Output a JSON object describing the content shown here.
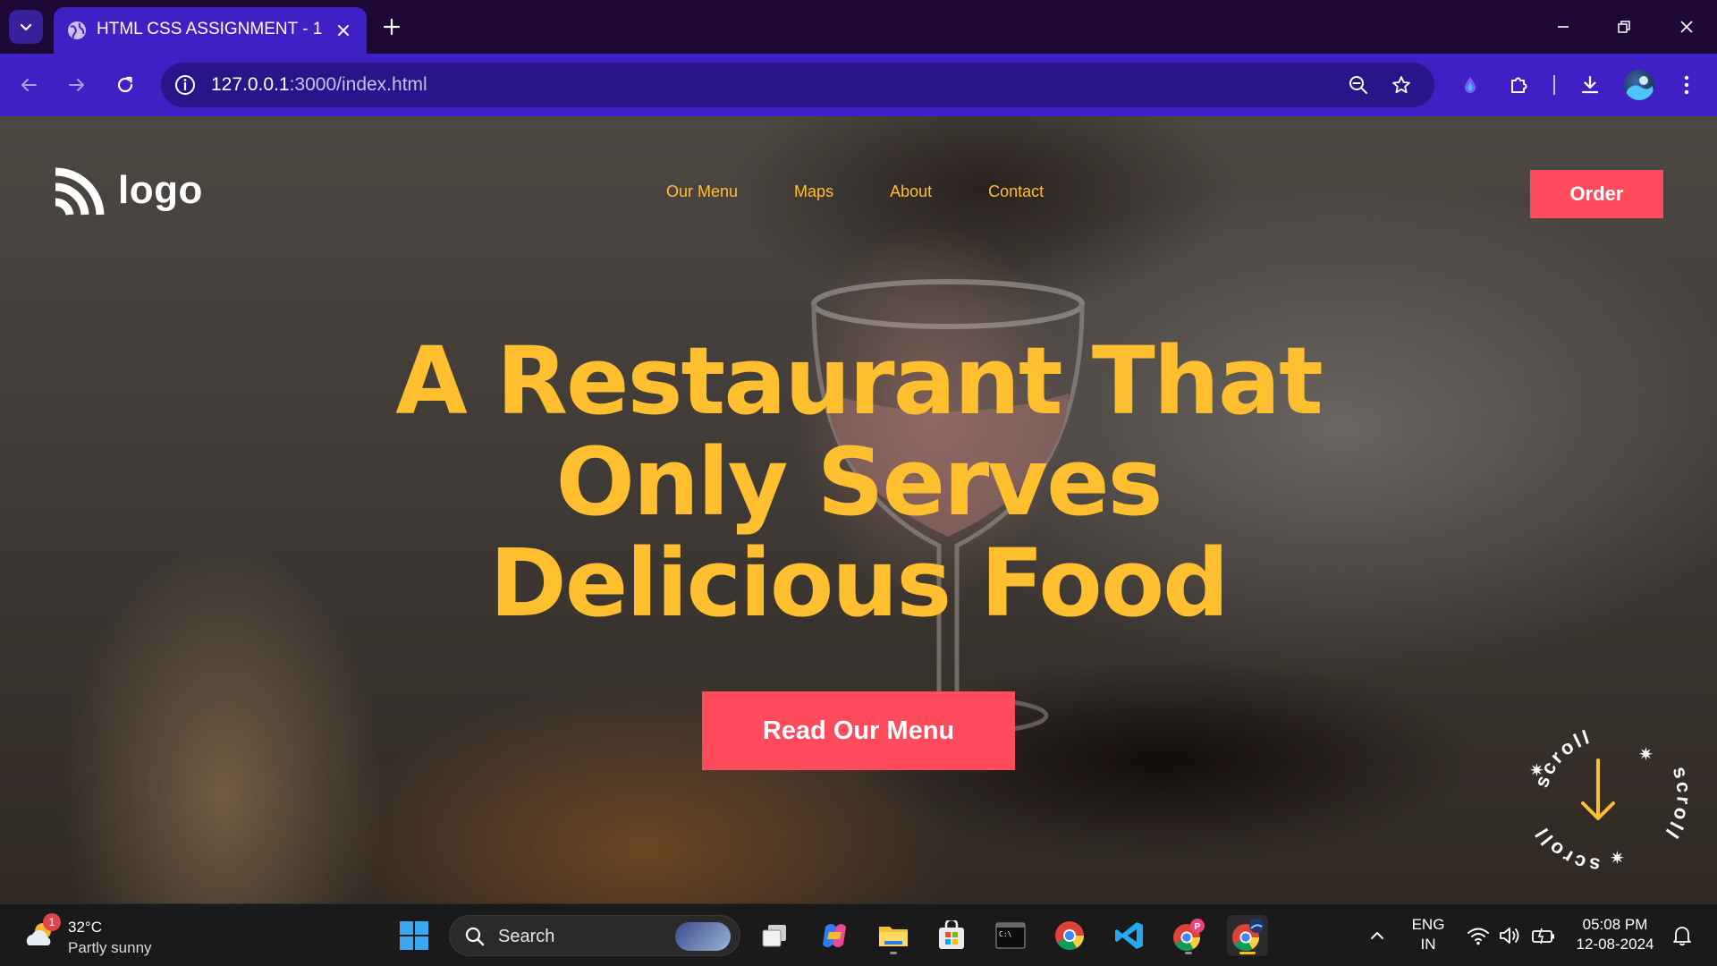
{
  "browser": {
    "tab": {
      "title": "HTML CSS ASSIGNMENT - 1"
    },
    "url": {
      "host": "127.0.0.1",
      "rest": ":3000/index.html"
    }
  },
  "site": {
    "logo_text": "logo",
    "nav": [
      {
        "label": "Our Menu"
      },
      {
        "label": "Maps"
      },
      {
        "label": "About"
      },
      {
        "label": "Contact"
      }
    ],
    "order_label": "Order",
    "headline": [
      "A Restaurant That",
      "Only Serves",
      "Delicious Food"
    ],
    "cta_label": "Read Our Menu",
    "scroll_text": "scroll",
    "colors": {
      "accent": "#ffbf2f",
      "button": "#ff4b5c"
    }
  },
  "taskbar": {
    "weather": {
      "temp": "32°C",
      "desc": "Partly sunny",
      "badge": "1"
    },
    "search_placeholder": "Search",
    "apps": [
      "task-view",
      "copilot",
      "file-explorer",
      "microsoft-store",
      "terminal",
      "chrome",
      "vscode",
      "chrome-profile",
      "chrome-active"
    ],
    "lang": {
      "line1": "ENG",
      "line2": "IN"
    },
    "clock": {
      "time": "05:08 PM",
      "date": "12-08-2024"
    }
  }
}
